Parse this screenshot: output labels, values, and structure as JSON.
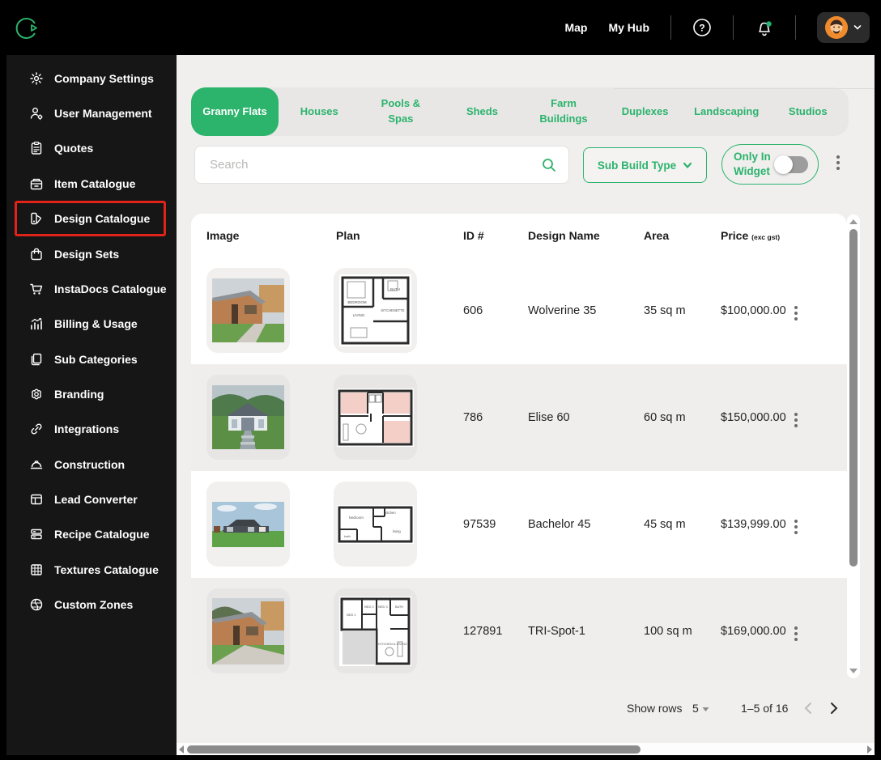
{
  "accent_green": "#2cb36c",
  "highlight_red": "#e2231a",
  "header": {
    "nav_map": "Map",
    "nav_myhub": "My Hub"
  },
  "sidebar": {
    "items": [
      {
        "label": "Company Settings",
        "icon": "gear"
      },
      {
        "label": "User Management",
        "icon": "user-gear"
      },
      {
        "label": "Quotes",
        "icon": "clipboard"
      },
      {
        "label": "Item Catalogue",
        "icon": "drawer"
      },
      {
        "label": "Design Catalogue",
        "icon": "swatches",
        "highlighted": true
      },
      {
        "label": "Design Sets",
        "icon": "bag"
      },
      {
        "label": "InstaDocs Catalogue",
        "icon": "cart"
      },
      {
        "label": "Billing & Usage",
        "icon": "chart"
      },
      {
        "label": "Sub Categories",
        "icon": "pages"
      },
      {
        "label": "Branding",
        "icon": "flower-gear"
      },
      {
        "label": "Integrations",
        "icon": "link"
      },
      {
        "label": "Construction",
        "icon": "hard-hat"
      },
      {
        "label": "Lead Converter",
        "icon": "window"
      },
      {
        "label": "Recipe Catalogue",
        "icon": "stack"
      },
      {
        "label": "Textures Catalogue",
        "icon": "grid"
      },
      {
        "label": "Custom Zones",
        "icon": "globe"
      }
    ]
  },
  "tabs": [
    {
      "label": "Granny Flats",
      "active": true
    },
    {
      "label": "Houses",
      "active": false
    },
    {
      "label": "Pools & Spas",
      "active": false
    },
    {
      "label": "Sheds",
      "active": false
    },
    {
      "label": "Farm Buildings",
      "active": false
    },
    {
      "label": "Duplexes",
      "active": false
    },
    {
      "label": "Landscaping",
      "active": false
    },
    {
      "label": "Studios",
      "active": false
    }
  ],
  "filters": {
    "search_placeholder": "Search",
    "sub_build_type_label": "Sub Build Type",
    "only_in_widget_line1": "Only In",
    "only_in_widget_line2": "Widget",
    "only_in_widget_on": false
  },
  "table": {
    "columns": {
      "image": "Image",
      "plan": "Plan",
      "id": "ID #",
      "name": "Design Name",
      "area": "Area",
      "price": "Price"
    },
    "price_note": "(exc gst)",
    "rows": [
      {
        "id": "606",
        "name": "Wolverine 35",
        "area": "35 sq m",
        "price": "$100,000.00"
      },
      {
        "id": "786",
        "name": "Elise 60",
        "area": "60 sq m",
        "price": "$150,000.00"
      },
      {
        "id": "97539",
        "name": "Bachelor 45",
        "area": "45 sq m",
        "price": "$139,999.00"
      },
      {
        "id": "127891",
        "name": "TRI-Spot-1",
        "area": "100 sq m",
        "price": "$169,000.00"
      }
    ]
  },
  "pagination": {
    "show_rows_label": "Show rows",
    "rows_per_page": "5",
    "range": "1–5 of 16"
  }
}
